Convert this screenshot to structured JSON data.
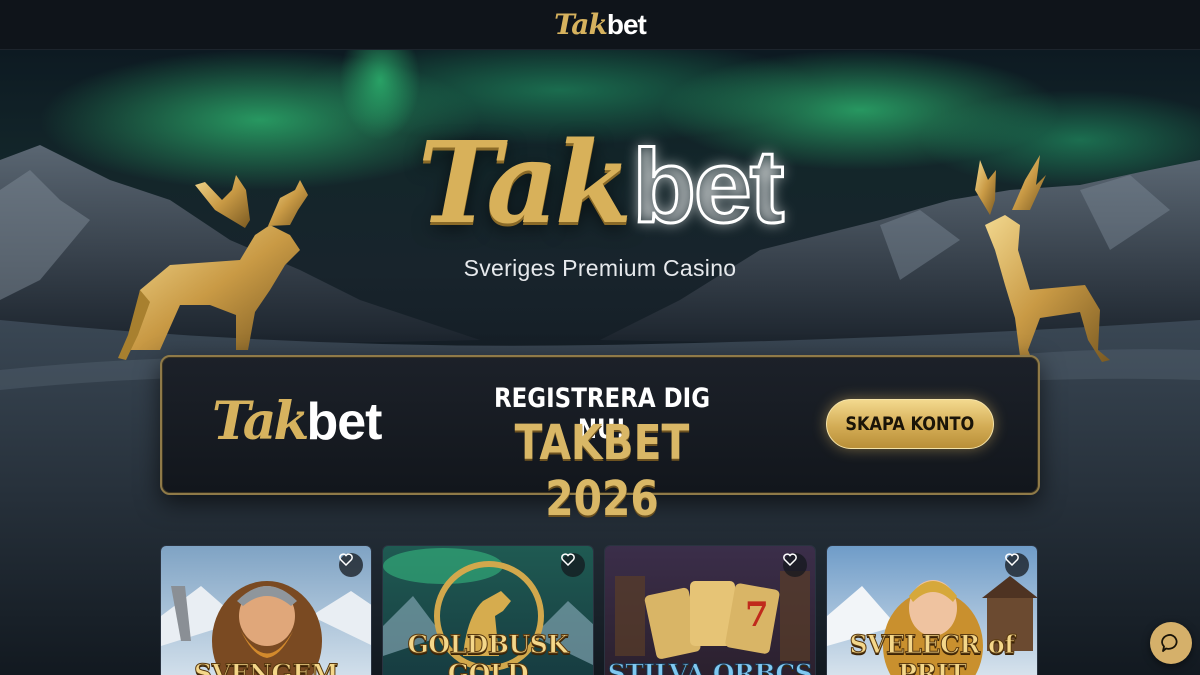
{
  "header": {
    "brand_tak": "Tak",
    "brand_bet": "bet"
  },
  "hero": {
    "logo_tak": "Tak",
    "logo_bet": "bet",
    "tagline": "Sveriges Premium Casino"
  },
  "promo": {
    "logo_tak": "Tak",
    "logo_bet": "bet",
    "headline": "REGISTRERA DIG NU!",
    "subheadline": "TAKBET 2026",
    "cta_label": "SKAPA KONTO"
  },
  "games": [
    {
      "title": "SVENGEM",
      "favorite_icon": "heart-icon"
    },
    {
      "title": "GOLDBUSK GOLD",
      "favorite_icon": "heart-icon"
    },
    {
      "title": "STILVA ORBCS",
      "favorite_icon": "heart-icon"
    },
    {
      "title": "SVELECR of PRIT",
      "favorite_icon": "heart-icon"
    }
  ],
  "chat": {
    "icon": "chat-bubble-icon"
  },
  "colors": {
    "gold": "#d6b25e",
    "background": "#0b1117",
    "cta_gold": "#d3ac55"
  }
}
